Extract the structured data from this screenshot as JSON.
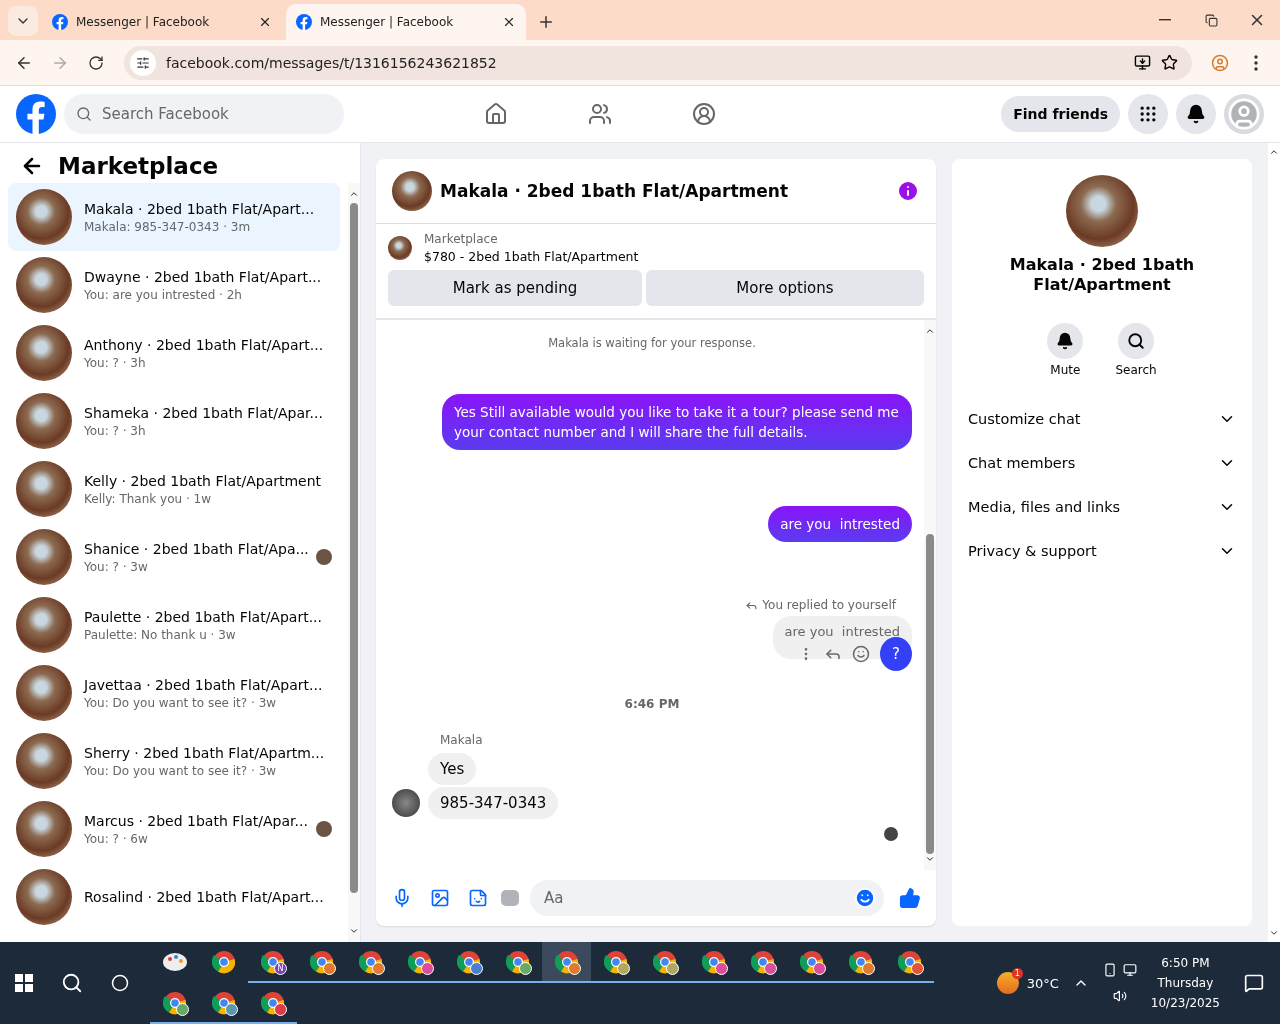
{
  "browser": {
    "tabs": [
      {
        "title": "Messenger | Facebook",
        "selected": false
      },
      {
        "title": "Messenger | Facebook",
        "selected": true
      }
    ],
    "url": "facebook.com/messages/t/1316156243621852"
  },
  "header": {
    "search_placeholder": "Search Facebook",
    "find_friends": "Find friends"
  },
  "sidebar": {
    "title": "Marketplace",
    "conversations": [
      {
        "title": "Makala · 2bed 1bath Flat/Apart...",
        "preview": "Makala: 985-347-0343 · 3m",
        "selected": true,
        "seen_avatar": false
      },
      {
        "title": "Dwayne · 2bed 1bath Flat/Apart...",
        "preview": "You: are you intrested · 2h",
        "selected": false,
        "seen_avatar": false
      },
      {
        "title": "Anthony · 2bed 1bath Flat/Apart...",
        "preview": "You: ? · 3h",
        "selected": false,
        "seen_avatar": false
      },
      {
        "title": "Shameka · 2bed 1bath Flat/Apar...",
        "preview": "You: ? · 3h",
        "selected": false,
        "seen_avatar": false
      },
      {
        "title": "Kelly · 2bed 1bath Flat/Apartment",
        "preview": "Kelly: Thank you · 1w",
        "selected": false,
        "seen_avatar": false
      },
      {
        "title": "Shanice · 2bed 1bath Flat/Apa...",
        "preview": "You: ? · 3w",
        "selected": false,
        "seen_avatar": true
      },
      {
        "title": "Paulette · 2bed 1bath Flat/Apart...",
        "preview": "Paulette: No thank u · 3w",
        "selected": false,
        "seen_avatar": false
      },
      {
        "title": "Javettaa · 2bed 1bath Flat/Apart...",
        "preview": "You: Do you want to see it? · 3w",
        "selected": false,
        "seen_avatar": false
      },
      {
        "title": "Sherry · 2bed 1bath Flat/Apartm...",
        "preview": "You: Do you want to see it? · 3w",
        "selected": false,
        "seen_avatar": false
      },
      {
        "title": "Marcus · 2bed 1bath Flat/Apar...",
        "preview": "You: ? · 6w",
        "selected": false,
        "seen_avatar": true
      },
      {
        "title": "Rosalind · 2bed 1bath Flat/Apart...",
        "selected": false,
        "seen_avatar": false
      }
    ]
  },
  "chat": {
    "title": "Makala · 2bed 1bath Flat/Apartment",
    "listing": {
      "label": "Marketplace",
      "price_title": "$780 - 2bed 1bath Flat/Apartment",
      "buttons": [
        "Mark as pending",
        "More options"
      ]
    },
    "messages": [
      {
        "kind": "notice",
        "text": "Makala is waiting for your response."
      },
      {
        "kind": "outgoing",
        "text": "Yes Still available would you like to take it a tour? please send me your contact number and I will share the full details."
      },
      {
        "kind": "outgoing",
        "text": "are you  intrested"
      },
      {
        "kind": "replied",
        "note": "You replied to yourself",
        "text": "are you  intrested",
        "action": "?"
      },
      {
        "kind": "timestamp",
        "text": "6:46 PM"
      },
      {
        "kind": "incoming",
        "sender": "Makala",
        "texts": [
          "Yes",
          "985-347-0343"
        ]
      }
    ],
    "composer_placeholder": "Aa"
  },
  "details": {
    "title": "Makala · 2bed 1bath Flat/Apartment",
    "actions": [
      {
        "kind": "bell",
        "label": "Mute"
      },
      {
        "kind": "search",
        "label": "Search"
      }
    ],
    "sections": [
      "Customize chat",
      "Chat members",
      "Media, files and links",
      "Privacy & support"
    ]
  },
  "taskbar": {
    "apps": [
      {
        "kind": "paint",
        "selected": false
      },
      {
        "kind": "chrome",
        "selected": false
      },
      {
        "kind": "chrome",
        "badge": "N",
        "color": "#7b3fbf",
        "selected": false
      },
      {
        "kind": "chrome",
        "color": "#e07a2e",
        "selected": false
      },
      {
        "kind": "chrome",
        "color": "#e07a2e",
        "selected": false
      },
      {
        "kind": "chrome",
        "color": "#d94f9a",
        "selected": false
      },
      {
        "kind": "chrome",
        "color": "#4a7fd4",
        "selected": false
      },
      {
        "kind": "chrome",
        "color": "#6aa86a",
        "selected": false
      },
      {
        "kind": "chrome",
        "color": "#e07a2e",
        "selected": true
      },
      {
        "kind": "chrome",
        "color": "#b0a860",
        "selected": false
      },
      {
        "kind": "chrome",
        "color": "#b0a860",
        "selected": false
      },
      {
        "kind": "chrome",
        "color": "#d94f9a",
        "selected": false
      },
      {
        "kind": "chrome",
        "color": "#d94f9a",
        "selected": false
      },
      {
        "kind": "chrome",
        "color": "#d94f9a",
        "selected": false
      },
      {
        "kind": "chrome",
        "color": "#e07a2e",
        "selected": false
      },
      {
        "kind": "chrome",
        "color": "#e0553a",
        "selected": false
      },
      {
        "kind": "chrome",
        "color": "#6aa86a",
        "selected": false
      },
      {
        "kind": "chrome",
        "color": "#5a9ab0",
        "selected": false
      },
      {
        "kind": "chrome",
        "color": "#e03a4a",
        "selected": false
      }
    ],
    "weather": {
      "badge": "1",
      "temp": "30°C"
    },
    "clock": {
      "time": "6:50 PM",
      "day": "Thursday",
      "date": "10/23/2025"
    }
  }
}
